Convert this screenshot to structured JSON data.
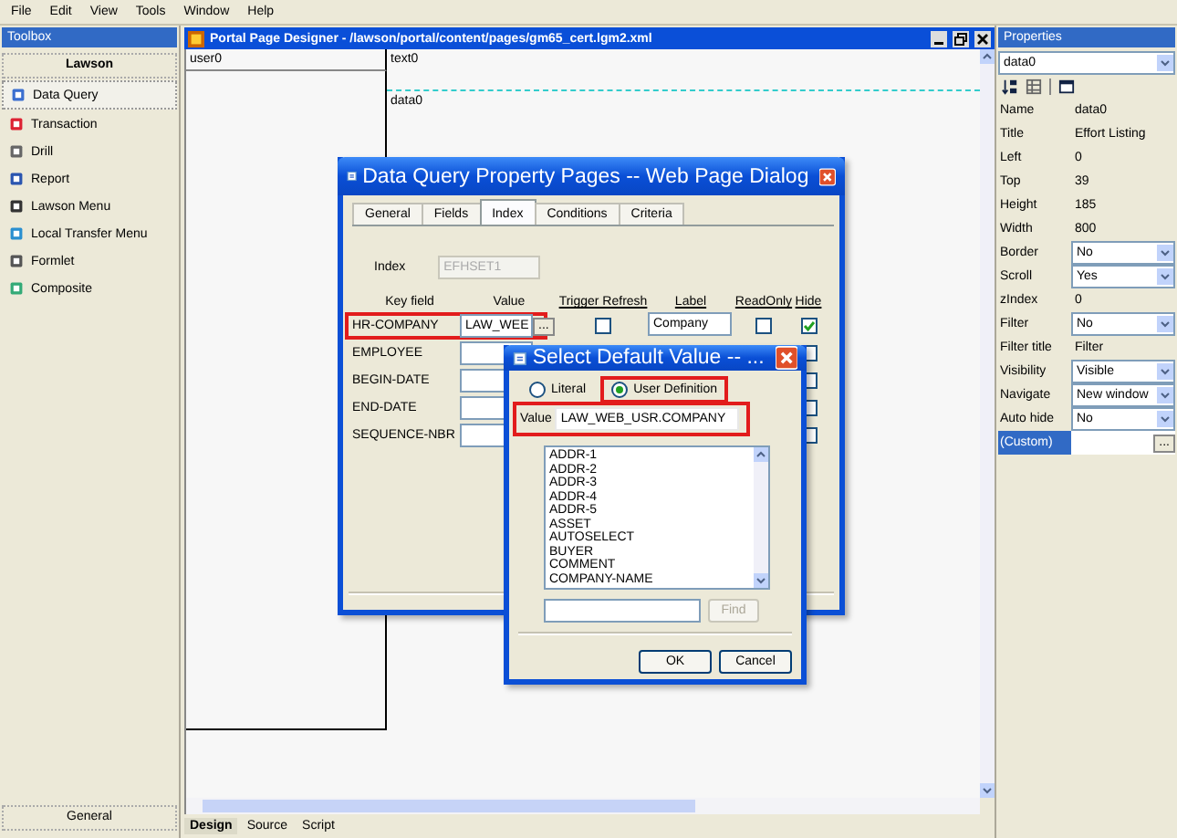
{
  "menu": [
    "File",
    "Edit",
    "View",
    "Tools",
    "Window",
    "Help"
  ],
  "toolbox": {
    "title": "Toolbox",
    "group": "Lawson",
    "items": [
      {
        "label": "Data Query",
        "selected": true
      },
      {
        "label": "Transaction",
        "selected": false
      },
      {
        "label": "Drill",
        "selected": false
      },
      {
        "label": "Report",
        "selected": false
      },
      {
        "label": "Lawson Menu",
        "selected": false
      },
      {
        "label": "Local Transfer Menu",
        "selected": false
      },
      {
        "label": "Formlet",
        "selected": false
      },
      {
        "label": "Composite",
        "selected": false
      }
    ],
    "footer": "General"
  },
  "designer": {
    "title": "Portal Page Designer - /lawson/portal/content/pages/gm65_cert.lgm2.xml",
    "regions": [
      {
        "kind": "user",
        "label": "user0"
      },
      {
        "kind": "text",
        "label": "text0"
      },
      {
        "kind": "data",
        "label": "data0"
      }
    ],
    "tabs": [
      {
        "label": "Design",
        "selected": true
      },
      {
        "label": "Source",
        "selected": false
      },
      {
        "label": "Script",
        "selected": false
      }
    ]
  },
  "properties": {
    "title": "Properties",
    "object": "data0",
    "rows": [
      {
        "name": "Name",
        "kind": "text",
        "value": "data0",
        "selected": false
      },
      {
        "name": "Title",
        "kind": "text",
        "value": "Effort Listing",
        "selected": false
      },
      {
        "name": "Left",
        "kind": "text",
        "value": "0",
        "selected": false
      },
      {
        "name": "Top",
        "kind": "text",
        "value": "39",
        "selected": false
      },
      {
        "name": "Height",
        "kind": "text",
        "value": "185",
        "selected": false
      },
      {
        "name": "Width",
        "kind": "text",
        "value": "800",
        "selected": false
      },
      {
        "name": "Border",
        "kind": "select",
        "value": "No",
        "selected": false
      },
      {
        "name": "Scroll",
        "kind": "select",
        "value": "Yes",
        "selected": false
      },
      {
        "name": "zIndex",
        "kind": "text",
        "value": "0",
        "selected": false
      },
      {
        "name": "Filter",
        "kind": "select",
        "value": "No",
        "selected": false
      },
      {
        "name": "Filter title",
        "kind": "text",
        "value": "Filter",
        "selected": false
      },
      {
        "name": "Visibility",
        "kind": "select",
        "value": "Visible",
        "selected": false
      },
      {
        "name": "Navigate",
        "kind": "select",
        "value": "New window",
        "selected": false
      },
      {
        "name": "Auto hide",
        "kind": "select",
        "value": "No",
        "selected": false
      },
      {
        "name": "(Custom)",
        "kind": "custom",
        "button": "...",
        "selected": true
      }
    ]
  },
  "property_dialog": {
    "title": "Data Query Property Pages -- Web Page Dialog",
    "tabs": [
      {
        "label": "General",
        "selected": false
      },
      {
        "label": "Fields",
        "selected": false
      },
      {
        "label": "Index",
        "selected": true
      },
      {
        "label": "Conditions",
        "selected": false
      },
      {
        "label": "Criteria",
        "selected": false
      }
    ],
    "index_label": "Index",
    "index_value": "EFHSET1",
    "columns": [
      "Key field",
      "Value",
      "Trigger Refresh",
      "Label",
      "ReadOnly",
      "Hide"
    ],
    "rows": [
      {
        "key": "HR-COMPANY",
        "value": "LAW_WEE",
        "browse": "...",
        "trigger": false,
        "label": "Company",
        "readonly": false,
        "hide": true,
        "highlighted": true
      },
      {
        "key": "EMPLOYEE",
        "hide": false,
        "highlighted": false
      },
      {
        "key": "BEGIN-DATE",
        "hide": false,
        "highlighted": false
      },
      {
        "key": "END-DATE",
        "hide": false,
        "highlighted": false
      },
      {
        "key": "SEQUENCE-NBR",
        "hide": false,
        "highlighted": false
      }
    ]
  },
  "value_dialog": {
    "title": "Select Default Value -- ...",
    "options": [
      {
        "label": "Literal",
        "selected": false,
        "highlighted": false
      },
      {
        "label": "User Definition",
        "selected": true,
        "highlighted": true
      }
    ],
    "value_label": "Value",
    "value": "LAW_WEB_USR.COMPANY",
    "value_highlighted": true,
    "list": [
      "ADDR-1",
      "ADDR-2",
      "ADDR-3",
      "ADDR-4",
      "ADDR-5",
      "ASSET",
      "AUTOSELECT",
      "BUYER",
      "COMMENT",
      "COMPANY-NAME"
    ],
    "find": {
      "label": "Find",
      "disabled": true
    },
    "buttons": [
      "OK",
      "Cancel"
    ]
  }
}
